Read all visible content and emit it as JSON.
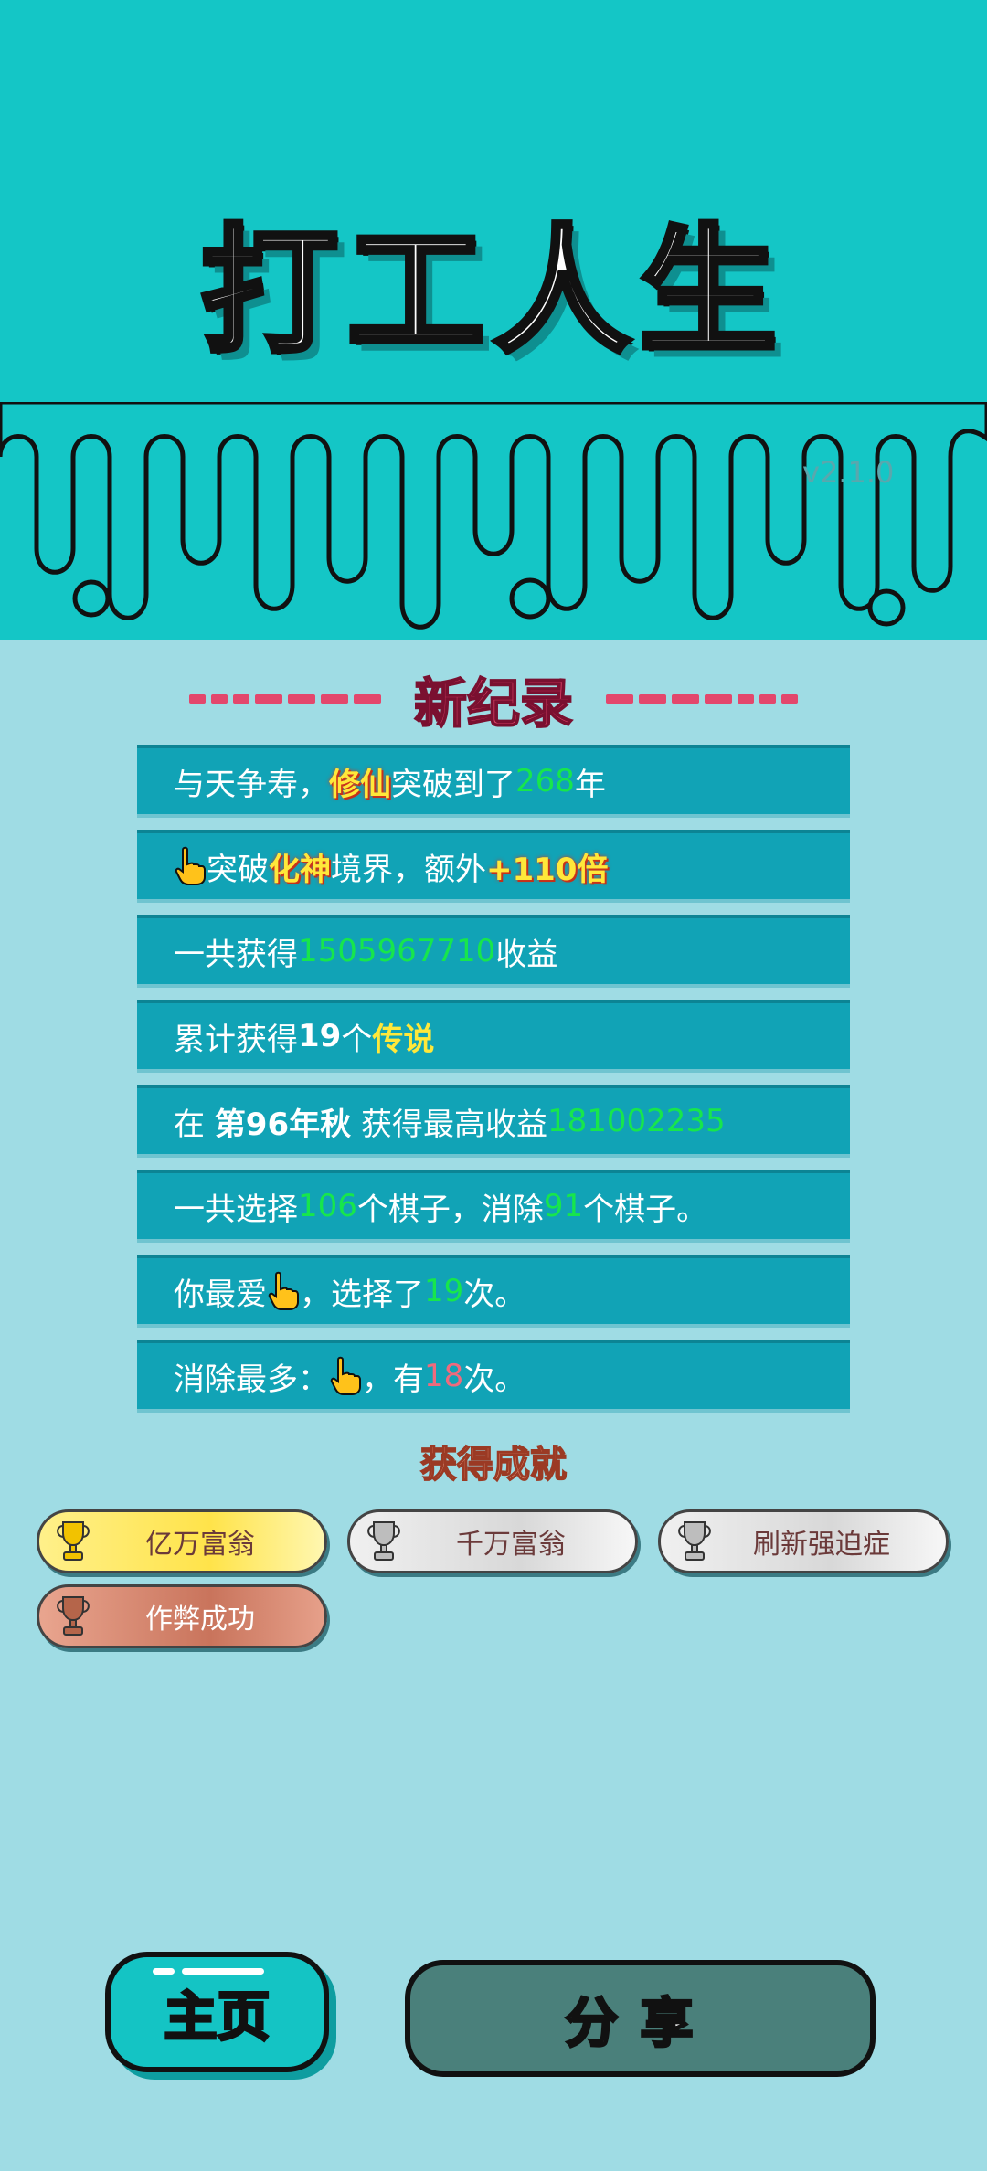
{
  "app": {
    "title": "打工人生",
    "version": "v2.1.0"
  },
  "record": {
    "heading": "新纪录"
  },
  "rows": [
    {
      "t1": "与天争寿，",
      "h1": "修仙",
      "t2": "突破到了",
      "n1": "268",
      "t3": "年"
    },
    {
      "icon": "pointing-hand-icon",
      "t1": "突破",
      "h1": "化神",
      "t2": "境界，额外",
      "h2": "+110倍"
    },
    {
      "t1": "一共获得",
      "n1": "1505967710",
      "t2": "收益"
    },
    {
      "t1": "累计获得",
      "b1": "19",
      "t2": "个",
      "y1": "传说"
    },
    {
      "t1": "在 ",
      "b1": "第96年秋",
      "t2": " 获得最高收益",
      "n1": "181002235"
    },
    {
      "t1": "一共选择",
      "n1": "106",
      "t2": "个棋子，消除",
      "n2": "91",
      "t3": "个棋子。"
    },
    {
      "t1": "你最爱",
      "icon": "pointing-hand-icon",
      "t2": "，选择了",
      "n1": "19",
      "t3": "次。"
    },
    {
      "t1": "消除最多：",
      "icon": "pointing-hand-icon",
      "t2": "，有",
      "r1": "18",
      "t3": "次。"
    }
  ],
  "achievements": {
    "heading": "获得成就",
    "items": [
      {
        "label": "亿万富翁",
        "tier": "gold",
        "icon": "trophy-icon"
      },
      {
        "label": "千万富翁",
        "tier": "silver",
        "icon": "trophy-icon"
      },
      {
        "label": "刷新强迫症",
        "tier": "silver",
        "icon": "trophy-icon"
      },
      {
        "label": "作弊成功",
        "tier": "bronze",
        "icon": "trophy-icon"
      }
    ]
  },
  "buttons": {
    "home": "主页",
    "share": "分享"
  },
  "colors": {
    "top_band": "#14c6c6",
    "background": "#9fdce4",
    "row": "#11a3b6",
    "accent_red": "#e3476c",
    "number_green": "#17e64c"
  }
}
